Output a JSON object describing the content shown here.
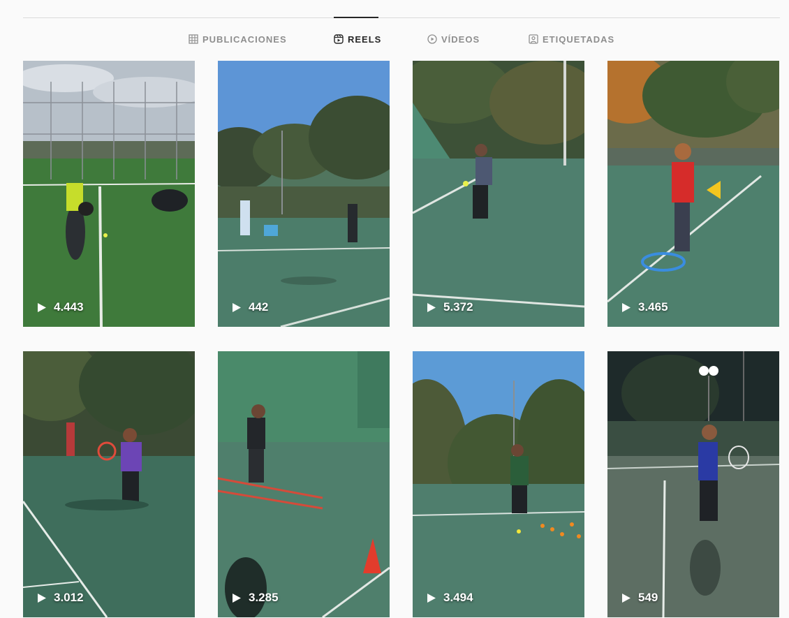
{
  "tabs": [
    {
      "id": "publicaciones",
      "label": "PUBLICACIONES",
      "icon": "grid-icon",
      "active": false
    },
    {
      "id": "reels",
      "label": "REELS",
      "icon": "reels-icon",
      "active": true
    },
    {
      "id": "videos",
      "label": "VÍDEOS",
      "icon": "play-circle-icon",
      "active": false
    },
    {
      "id": "etiquetadas",
      "label": "ETIQUETADAS",
      "icon": "tagged-icon",
      "active": false
    }
  ],
  "reels": [
    {
      "views": "4.443"
    },
    {
      "views": "442"
    },
    {
      "views": "5.372"
    },
    {
      "views": "3.465"
    },
    {
      "views": "3.012"
    },
    {
      "views": "3.285"
    },
    {
      "views": "3.494"
    },
    {
      "views": "549"
    }
  ],
  "colors": {
    "tab_active": "#262626",
    "tab_inactive": "#8e8e8e",
    "divider": "#dbdbdb",
    "background": "#fafafa"
  }
}
